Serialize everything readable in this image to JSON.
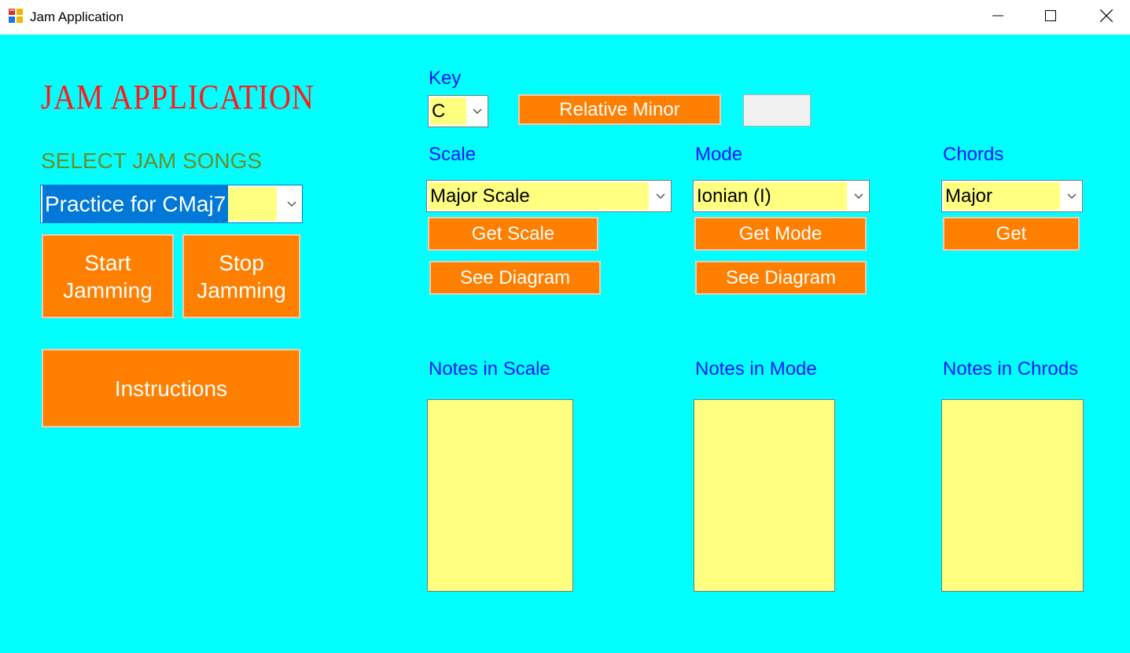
{
  "window": {
    "title": "Jam Application",
    "icon": "app-icon",
    "controls": [
      "minimize-icon",
      "maximize-icon",
      "close-icon"
    ]
  },
  "colors": {
    "background": "#00ffff",
    "button": "#ff7f00",
    "field": "#ffff80",
    "heading_red": "#ff1a1a",
    "label_blue": "#0a14ff",
    "label_green": "#6b8e23"
  },
  "left": {
    "app_title": "JAM APPLICATION",
    "select_label": "SELECT JAM SONGS",
    "song_select": {
      "value": "Practice for CMaj7"
    },
    "start_button": {
      "line1": "Start",
      "line2": "Jamming"
    },
    "stop_button": {
      "line1": "Stop",
      "line2": "Jamming"
    },
    "instructions_button": "Instructions"
  },
  "key": {
    "label": "Key",
    "value": "C",
    "relative_minor_button": "Relative Minor",
    "relative_minor_result": ""
  },
  "scale": {
    "label": "Scale",
    "value": "Major Scale",
    "get_button": "Get Scale",
    "diagram_button": "See Diagram",
    "notes_label": "Notes in Scale"
  },
  "mode": {
    "label": "Mode",
    "value": "Ionian (I)",
    "get_button": "Get Mode",
    "diagram_button": "See Diagram",
    "notes_label": "Notes in Mode"
  },
  "chords": {
    "label": "Chords",
    "value": "Major",
    "get_button": "Get",
    "notes_label": "Notes in Chrods"
  }
}
